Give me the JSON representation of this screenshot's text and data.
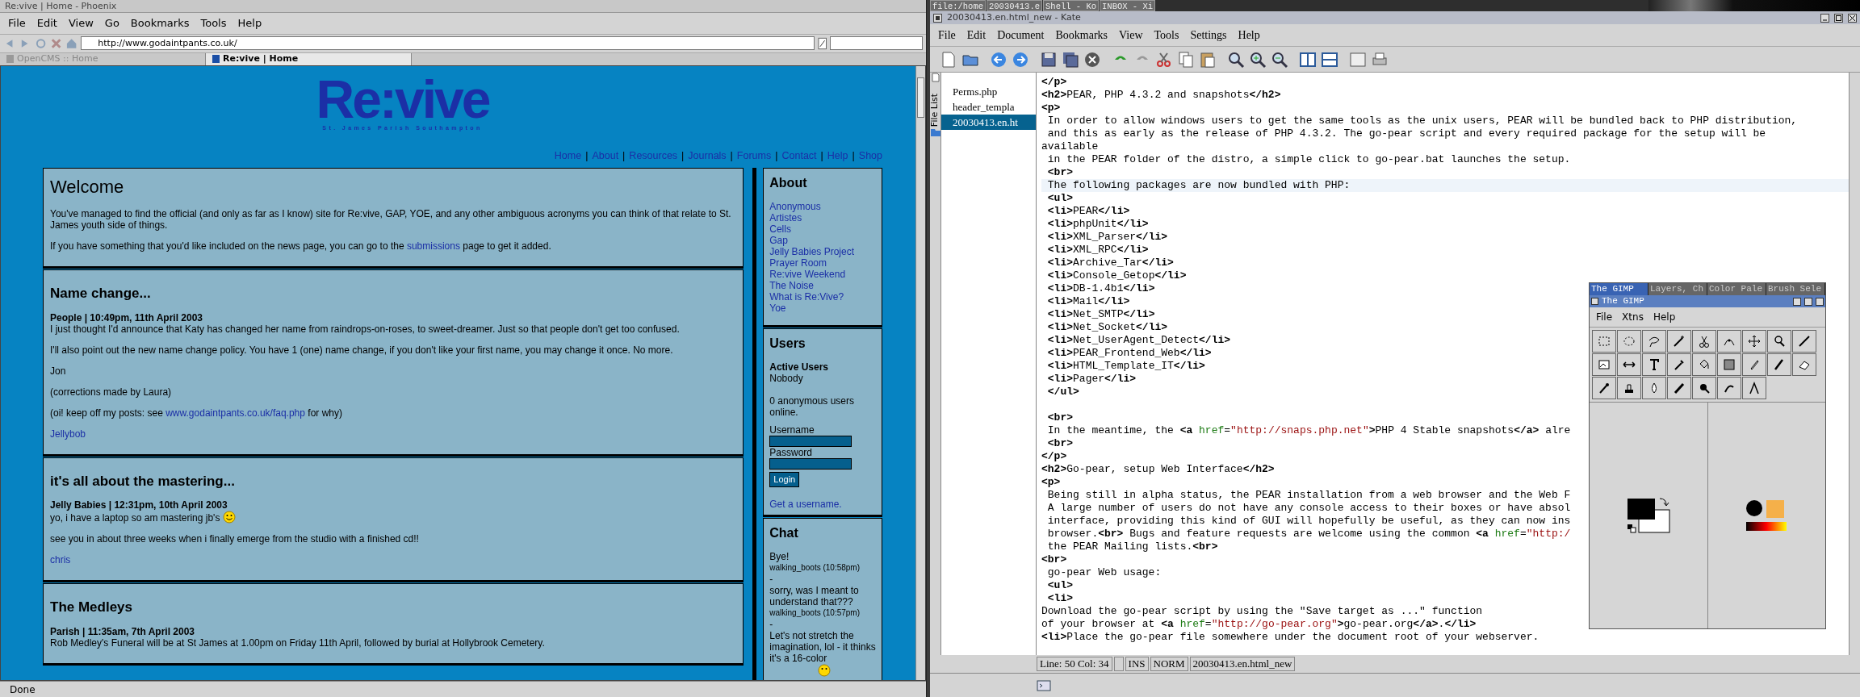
{
  "browser": {
    "title": "Re:vive | Home - Phoenix",
    "menu": [
      "File",
      "Edit",
      "View",
      "Go",
      "Bookmarks",
      "Tools",
      "Help"
    ],
    "url": "http://www.godaintpants.co.uk/",
    "tabs": [
      {
        "label": "OpenCMS :: Home",
        "selected": false
      },
      {
        "label": "Re:vive | Home",
        "selected": true
      }
    ],
    "status": "Done"
  },
  "site": {
    "logo": "Re:vive",
    "tagline": "St. James Parish Southampton",
    "nav": [
      "Home",
      "About",
      "Resources",
      "Journals",
      "Forums",
      "Contact",
      "Help",
      "Shop"
    ],
    "nav_separator": "|",
    "posts": [
      {
        "kind": "intro",
        "title": "Welcome",
        "paragraphs": [
          {
            "text": "You've managed to find the official (and only as far as I know) site for Re:vive, GAP, YOE, and any other ambiguous acronyms you can think of that relate to St. James youth side of things."
          },
          {
            "before": "If you have something that you'd like included on the news page, you can go to the ",
            "link": "submissions",
            "after": " page to get it added."
          }
        ]
      },
      {
        "kind": "news",
        "title": "Name change...",
        "meta": "People | 10:49pm, 11th April 2003",
        "paragraphs": [
          {
            "text": "I just thought I'd announce that Katy has changed her name from raindrops-on-roses, to sweet-dreamer. Just so that people don't get too confused."
          },
          {
            "text": "I'll also point out the new name change policy. You have 1 (one) name change, if you don't like your first name, you may change it once. No more."
          },
          {
            "text": "Jon"
          },
          {
            "text": "(corrections made by Laura)"
          },
          {
            "before": "(oi! keep off my posts: see ",
            "link": "www.godaintpants.co.uk/faq.php",
            "after": " for why)"
          }
        ],
        "author": "Jellybob"
      },
      {
        "kind": "news",
        "title": "it's all about the mastering...",
        "meta": "Jelly Babies | 12:31pm, 10th April 2003",
        "paragraphs": [
          {
            "text": "yo, i have a laptop so am mastering jb's",
            "smiley": true
          },
          {
            "text": "see you in about three weeks when i finally emerge from the studio with a finished cd!!"
          }
        ],
        "author": "chris"
      },
      {
        "kind": "news",
        "title": "The Medleys",
        "meta": "Parish | 11:35am, 7th April 2003",
        "paragraphs": [
          {
            "text": "Rob Medley's Funeral will be at St James at 1.00pm on Friday 11th April, followed by burial at Hollybrook Cemetery."
          }
        ]
      }
    ],
    "about": {
      "title": "About",
      "links": [
        "Anonymous",
        "Artistes",
        "Cells",
        "Gap",
        "Jelly Babies Project",
        "Prayer Room",
        "Re:vive Weekend",
        "The Noise",
        "What is Re:Vive?",
        "Yoe"
      ]
    },
    "users": {
      "title": "Users",
      "heading": "Active Users",
      "active": "Nobody",
      "anonymous": "0 anonymous users online.",
      "username_label": "Username",
      "password_label": "Password",
      "login": "Login",
      "signup": "Get a username."
    },
    "chat": {
      "title": "Chat",
      "lines": [
        {
          "kind": "message",
          "text": "Bye!"
        },
        {
          "kind": "author",
          "text": "walking_boots (10:58pm)"
        },
        {
          "kind": "separator",
          "text": "-"
        },
        {
          "kind": "message",
          "text": "sorry, was I meant to understand that???"
        },
        {
          "kind": "author",
          "text": "walking_boots (10:57pm)"
        },
        {
          "kind": "separator",
          "text": "-"
        },
        {
          "kind": "message",
          "text": "Let's not stretch the imagination, lol - it thinks it's a 16-color"
        }
      ]
    }
  },
  "taskbar": [
    "file:/home",
    "20030413.e",
    "Shell - Ko",
    "INBOX - Xi"
  ],
  "editor": {
    "title": "20030413.en.html_new - Kate",
    "menu": [
      "File",
      "Edit",
      "Document",
      "Bookmarks",
      "View",
      "Tools",
      "Settings",
      "Help"
    ],
    "sidebar_tab": "File List",
    "files": [
      {
        "name": "Perms.php",
        "selected": false
      },
      {
        "name": "header_templa",
        "selected": false
      },
      {
        "name": "20030413.en.ht",
        "selected": true
      }
    ],
    "lines": [
      {
        "text": "</p>",
        "current": false
      },
      {
        "text": "<h2>PEAR, PHP 4.3.2 and snapshots</h2>",
        "current": false
      },
      {
        "text": "<p>",
        "current": false
      },
      {
        "text": " In order to allow windows users to get the same tools as the unix users, PEAR will be bundled back to PHP distribution,",
        "current": false
      },
      {
        "text": " and this as early as the release of PHP 4.3.2. The go-pear script and every required package for the setup will be",
        "current": false
      },
      {
        "text": "available",
        "current": false
      },
      {
        "text": " in the PEAR folder of the distro, a simple click to go-pear.bat launches the setup.",
        "current": false
      },
      {
        "text": " <br>",
        "current": false
      },
      {
        "text": " The following packages are now bundled with PHP:",
        "current": true
      },
      {
        "text": " <ul>",
        "current": false
      },
      {
        "text": " <li>PEAR</li>",
        "current": false
      },
      {
        "text": " <li>phpUnit</li>",
        "current": false
      },
      {
        "text": " <li>XML_Parser</li>",
        "current": false
      },
      {
        "text": " <li>XML_RPC</li>",
        "current": false
      },
      {
        "text": " <li>Archive_Tar</li>",
        "current": false
      },
      {
        "text": " <li>Console_Getop</li>",
        "current": false
      },
      {
        "text": " <li>DB-1.4b1</li>",
        "current": false
      },
      {
        "text": " <li>Mail</li>",
        "current": false
      },
      {
        "text": " <li>Net_SMTP</li>",
        "current": false
      },
      {
        "text": " <li>Net_Socket</li>",
        "current": false
      },
      {
        "text": " <li>Net_UserAgent_Detect</li>",
        "current": false
      },
      {
        "text": " <li>PEAR_Frontend_Web</li>",
        "current": false
      },
      {
        "text": " <li>HTML_Template_IT</li>",
        "current": false
      },
      {
        "text": " <li>Pager</li>",
        "current": false
      },
      {
        "text": " </ul>",
        "current": false
      },
      {
        "current": false
      },
      {
        "text": " <br>",
        "current": false
      },
      {
        "text": " In the meantime, the <a href=\"http://snaps.php.net\">PHP 4 Stable snapshots</a> alre",
        "current": false
      },
      {
        "text": " <br>",
        "current": false
      },
      {
        "text": "</p>",
        "current": false
      },
      {
        "text": "<h2>Go-pear, setup Web Interface</h2>",
        "current": false
      },
      {
        "text": "<p>",
        "current": false
      },
      {
        "text": " Being still in alpha status, the PEAR installation from a web browser and the Web F",
        "current": false
      },
      {
        "text": " A large number of users do not have any console access to their boxes or have absol",
        "current": false
      },
      {
        "text": " interface, providing this kind of GUI will hopefully be useful, as they can now ins",
        "current": false
      },
      {
        "text": " browser.<br> Bugs and feature requests are welcome using the common <a href=\"http:/",
        "current": false
      },
      {
        "text": " the PEAR Mailing lists.<br>",
        "current": false
      },
      {
        "text": "<br>",
        "current": false
      },
      {
        "text": " go-pear Web usage:",
        "current": false
      },
      {
        "text": " <ul>",
        "current": false
      },
      {
        "text": " <li>",
        "current": false
      },
      {
        "text": "Download the go-pear script by using the \"Save target as ...\" function",
        "current": false
      },
      {
        "text": "of your browser at <a href=\"http://go-pear.org\">go-pear.org</a>.</li>",
        "current": false
      },
      {
        "text": "<li>Place the go-pear file somewhere under the document root of your webserver.",
        "current": false
      }
    ],
    "status": [
      "Line: 50 Col: 34",
      "INS",
      "NORM",
      "20030413.en.html_new"
    ]
  },
  "gimp": {
    "tabs": [
      {
        "label": "The GIMP",
        "selected": true
      },
      {
        "label": "Layers, Ch",
        "selected": false
      },
      {
        "label": "Color Pale",
        "selected": false
      },
      {
        "label": "Brush Sele",
        "selected": false
      }
    ],
    "title": "The GIMP",
    "menu": [
      "File",
      "Xtns",
      "Help"
    ]
  }
}
